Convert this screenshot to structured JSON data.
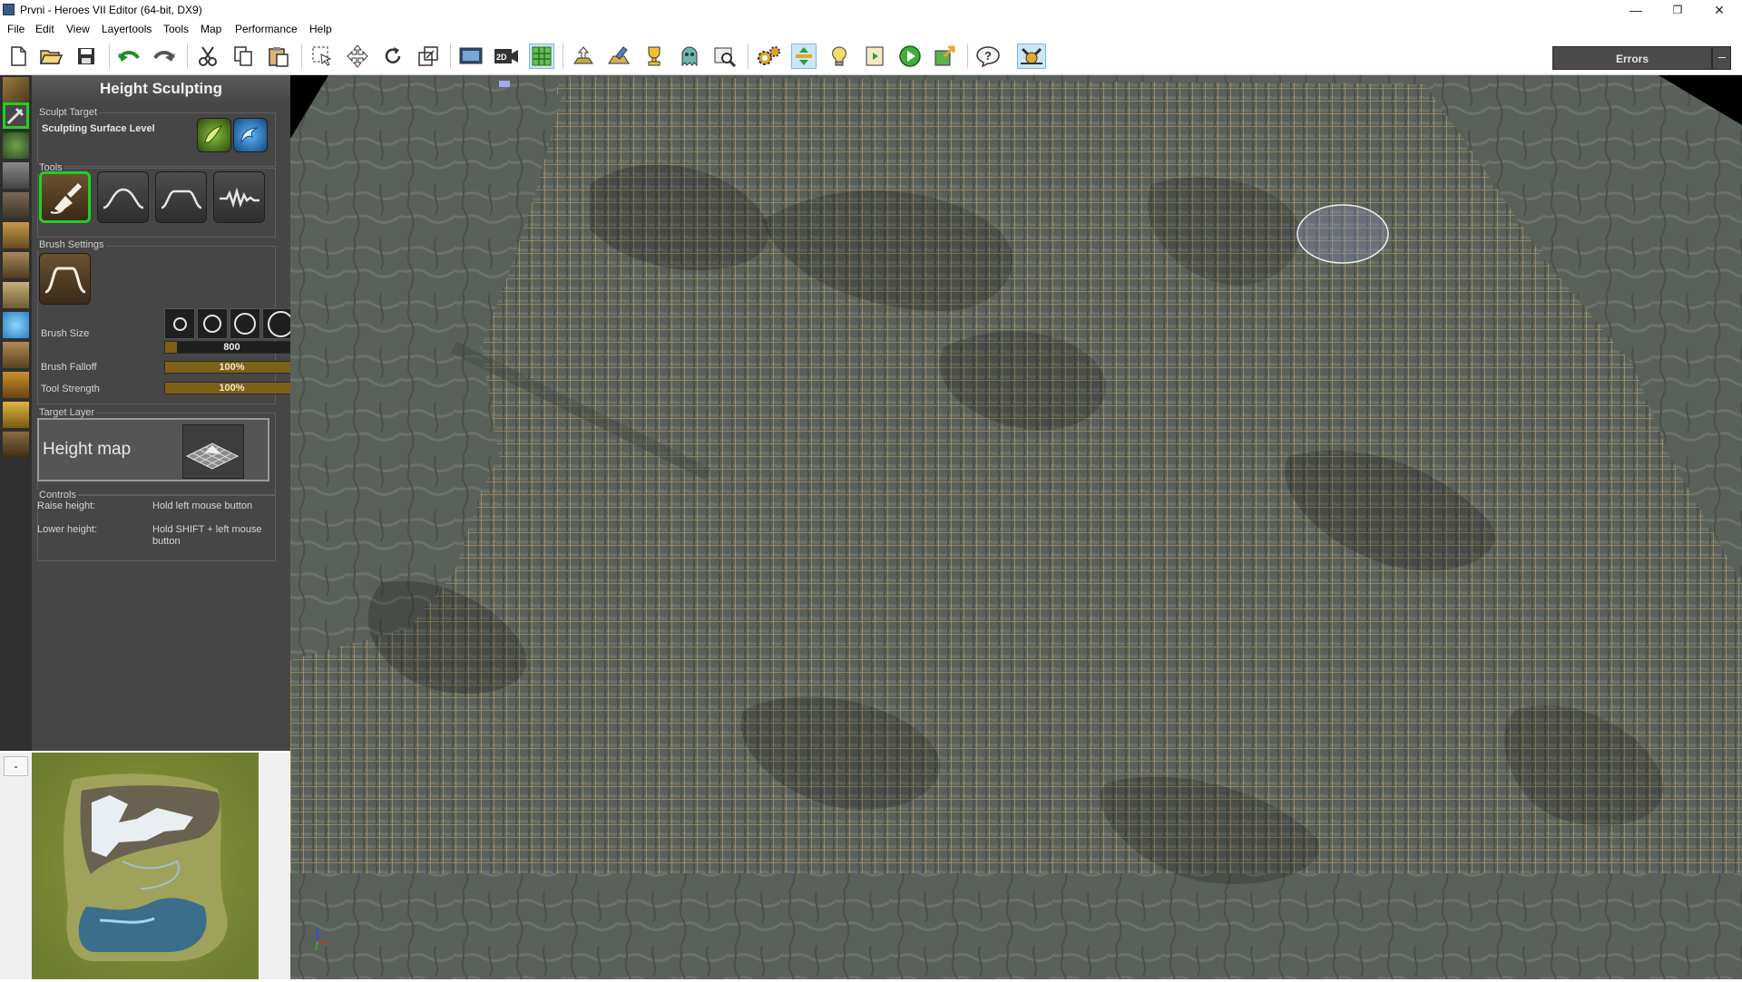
{
  "window": {
    "title": "Prvni - Heroes VII Editor (64-bit, DX9)",
    "minimize": "—",
    "restore": "❐",
    "close": "✕"
  },
  "menu": [
    "File",
    "Edit",
    "View",
    "Layertools",
    "Tools",
    "Map",
    "Performance",
    "Help"
  ],
  "toolbar": {
    "errors_label": "Errors",
    "buttons": [
      "new-file-icon",
      "open-folder-icon",
      "save-icon",
      "undo-icon",
      "redo-icon",
      "cut-icon",
      "copy-icon",
      "paste-icon",
      "select-icon",
      "move-icon",
      "rotate-icon",
      "scale-icon",
      "screenshot-icon",
      "2d-view-icon",
      "grid-toggle-icon",
      "terrain-up-icon",
      "terrain-paint-icon",
      "trophy-icon",
      "ghost-icon",
      "magnifier-icon",
      "settings-gears-icon",
      "gizmo-icon",
      "lightbulb-icon",
      "script-icon",
      "play-icon",
      "export-icon",
      "help-icon",
      "debug-icon"
    ]
  },
  "panel": {
    "title": "Height Sculpting",
    "sculpt_target": {
      "label": "Sculpt Target",
      "value": "Sculpting Surface Level"
    },
    "tools_label": "Tools",
    "brush_settings_label": "Brush Settings",
    "brush_size_label": "Brush Size",
    "brush_size_value": "800",
    "brush_falloff_label": "Brush Falloff",
    "brush_falloff_value": "100%",
    "tool_strength_label": "Tool Strength",
    "tool_strength_value": "100%",
    "target_layer_label": "Target Layer",
    "target_layer_value": "Height map",
    "controls_label": "Controls",
    "controls": [
      {
        "action": "Raise height:",
        "binding": "Hold left mouse button"
      },
      {
        "action": "Lower height:",
        "binding": "Hold SHIFT + left mouse button"
      }
    ]
  },
  "minimap": {
    "collapse_label": "-"
  },
  "colors": {
    "selection_green": "#22d022",
    "slider_gold": "#7e5f16",
    "panel_bg": "#464646",
    "grid_line": "#c8a964"
  }
}
